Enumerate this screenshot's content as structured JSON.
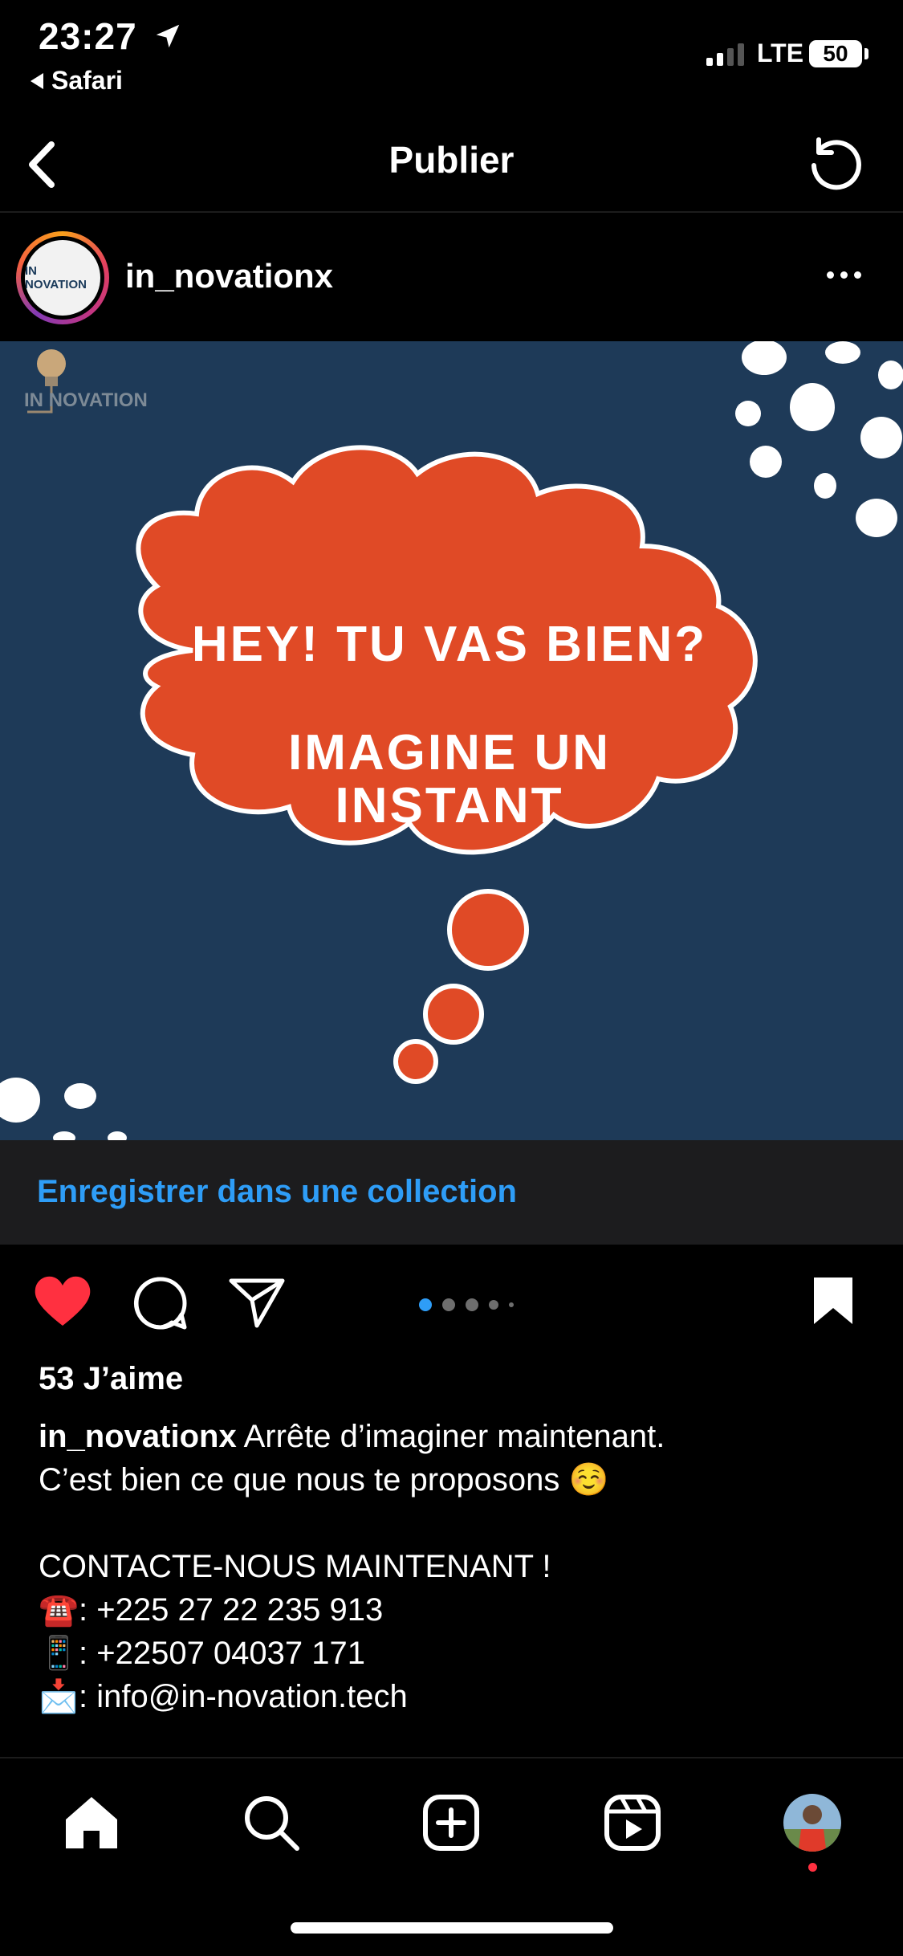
{
  "status_bar": {
    "time": "23:27",
    "back_app": "Safari",
    "network": "LTE",
    "battery": "50"
  },
  "nav": {
    "title": "Publier",
    "back_icon": "chevron-left-icon",
    "refresh_icon": "refresh-icon"
  },
  "post": {
    "username": "in_novationx",
    "avatar_text": "IN NOVATION",
    "image": {
      "brand": "IN NOVATION",
      "line1": "HEY! TU VAS BIEN?",
      "line2": "IMAGINE UN",
      "line3": "INSTANT",
      "colors": {
        "background": "#1e3a58",
        "cloud": "#e04a26",
        "outline": "#ffffff"
      }
    },
    "save_collection": "Enregistrer dans une collection",
    "carousel": {
      "count": 5,
      "active": 1
    },
    "likes": "53 J’aime",
    "caption": {
      "user": "in_novationx",
      "text1": "Arrête d’imaginer maintenant.",
      "text2": "C’est bien ce que nous te proposons",
      "text2_emoji": "☺️",
      "contact_title": "CONTACTE-NOUS MAINTENANT !",
      "phone1_icon": "☎️",
      "phone1": ": +225 27 22 235 913",
      "phone2_icon": "📱",
      "phone2": ": +22507 04037 171",
      "email_icon": "📩",
      "email": ": info@in-novation.tech"
    }
  },
  "tab_bar": {
    "items": [
      "home-icon",
      "search-icon",
      "create-post-icon",
      "reels-icon",
      "profile-avatar"
    ]
  },
  "colors": {
    "accent": "#2e9df7",
    "like": "#ff3040"
  }
}
